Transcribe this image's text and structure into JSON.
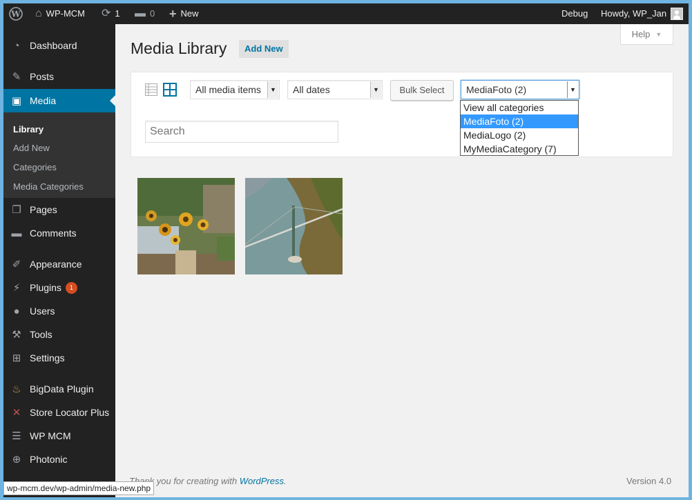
{
  "adminbar": {
    "wp_logo": "wordpress-logo",
    "site_name": "WP-MCM",
    "updates_count": "1",
    "comments_count": "0",
    "new_label": "New",
    "debug_label": "Debug",
    "howdy": "Howdy, WP_Jan"
  },
  "sidebar": {
    "dashboard": "Dashboard",
    "posts": "Posts",
    "media": "Media",
    "submenu": [
      "Library",
      "Add New",
      "Categories",
      "Media Categories"
    ],
    "pages": "Pages",
    "comments": "Comments",
    "appearance": "Appearance",
    "plugins": "Plugins",
    "plugins_badge": "1",
    "users": "Users",
    "tools": "Tools",
    "settings": "Settings",
    "bigdata": "BigData Plugin",
    "store_locator": "Store Locator Plus",
    "wp_mcm": "WP MCM",
    "photonic": "Photonic"
  },
  "main": {
    "title": "Media Library",
    "add_new": "Add New",
    "help": "Help",
    "filter_type": "All media items",
    "filter_dates": "All dates",
    "bulk_select": "Bulk Select",
    "category_selected": "MediaFoto  (2)",
    "category_options": [
      "View all categories",
      "MediaFoto  (2)",
      "MediaLogo  (2)",
      "MyMediaCategory  (7)"
    ],
    "search_placeholder": "Search"
  },
  "footer": {
    "thanks_prefix": "Thank you for creating with ",
    "thanks_link": "WordPress",
    "thanks_suffix": ".",
    "version": "Version 4.0"
  },
  "statusbar": {
    "url": "wp-mcm.dev/wp-admin/media-new.php"
  },
  "colors": {
    "adminbar_bg": "#222222",
    "menu_current": "#0074a2",
    "badge": "#d54e21",
    "link": "#0074a2",
    "dropdown_selected": "#3399ff"
  }
}
